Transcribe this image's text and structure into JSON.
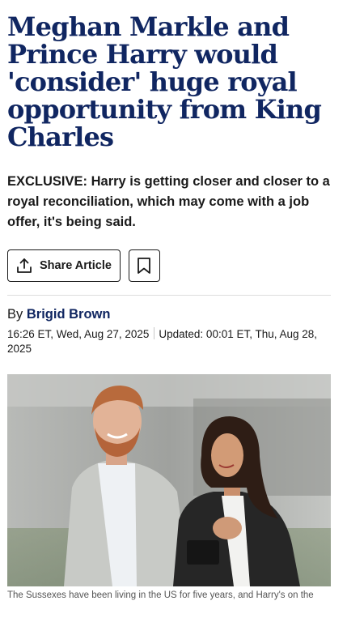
{
  "article": {
    "headline": "Meghan Markle and Prince Harry would 'consider' huge royal opportunity from King Charles",
    "standfirst": "EXCLUSIVE: Harry is getting closer and closer to a royal reconciliation, which may come with a job offer, it's being said.",
    "share_label": "Share Article",
    "byline_prefix": "By",
    "author": "Brigid Brown",
    "published": "16:26 ET, Wed, Aug 27, 2025",
    "updated": "Updated: 00:01 ET, Thu, Aug 28, 2025",
    "caption": "The Sussexes have been living in the US for five years, and Harry's on the"
  },
  "icons": {
    "share": "share-upload-icon",
    "bookmark": "bookmark-icon"
  },
  "colors": {
    "headline": "#102661",
    "author": "#102661",
    "text": "#1a1a1a"
  }
}
